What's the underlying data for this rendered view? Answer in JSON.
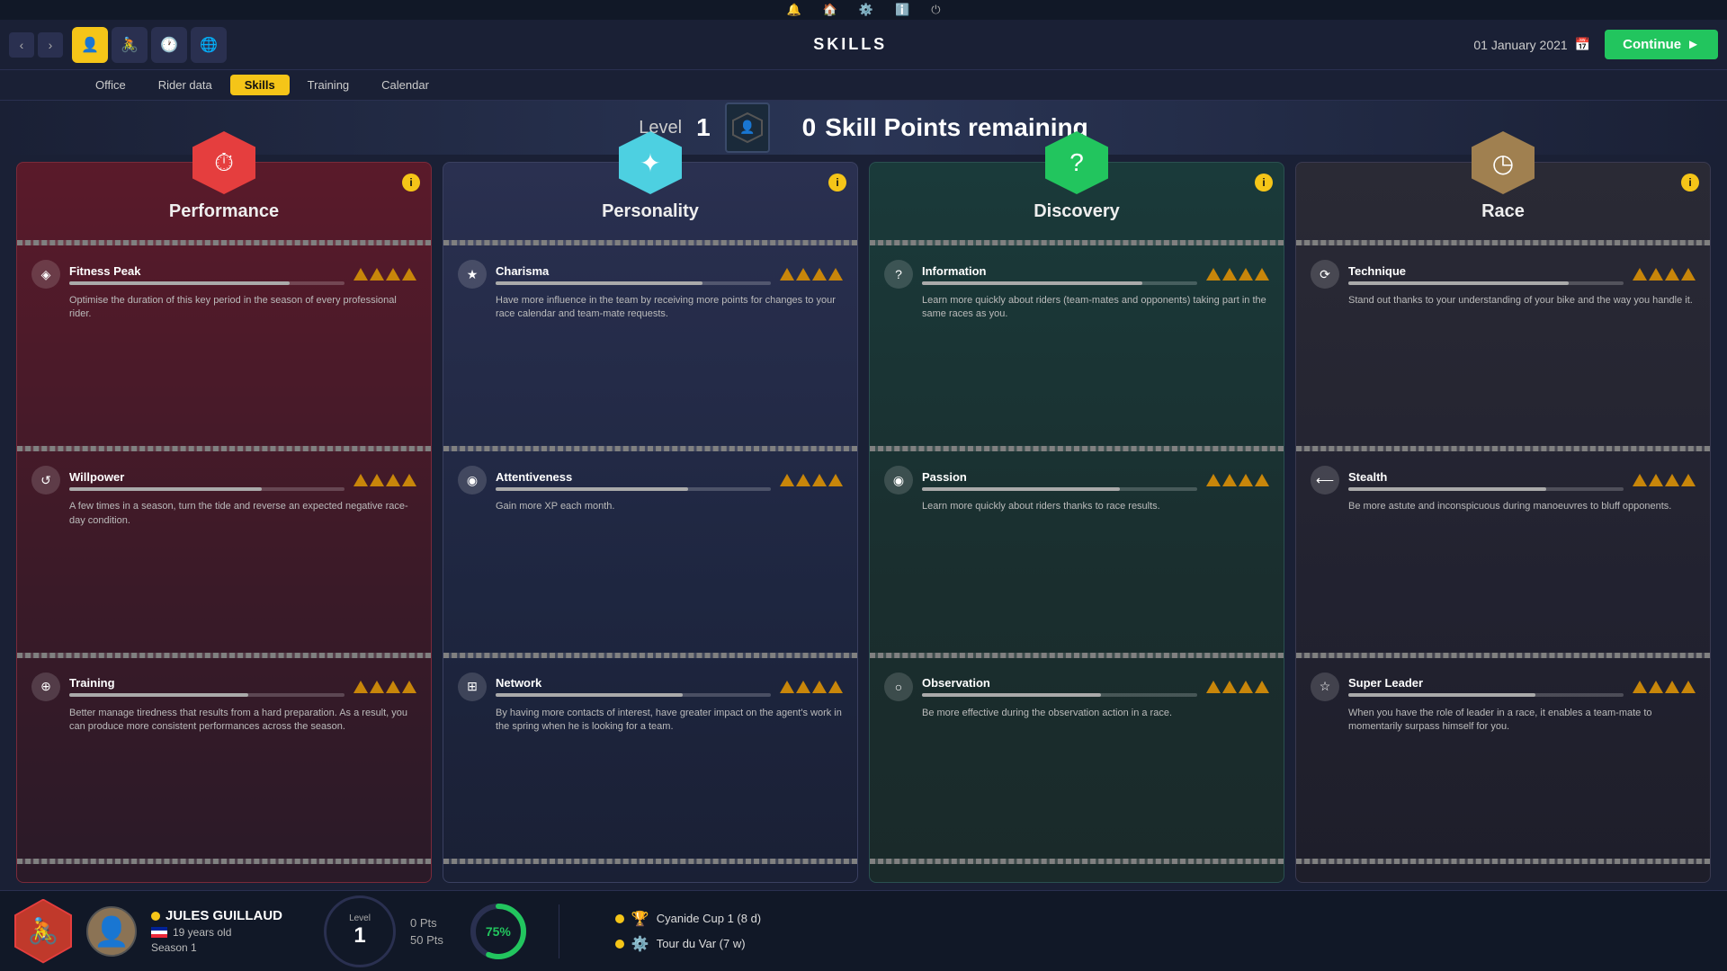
{
  "topbar": {
    "icons": [
      "🔔",
      "🏠",
      "⚙️",
      "ℹ️",
      "⏻"
    ]
  },
  "navbar": {
    "title": "SKILLS",
    "date": "01 January 2021",
    "continue_label": "Continue",
    "nav_icons": [
      {
        "name": "profile",
        "symbol": "👤",
        "active": true
      },
      {
        "name": "riders",
        "symbol": "🚴",
        "active": false
      },
      {
        "name": "clock",
        "symbol": "🕐",
        "active": false
      },
      {
        "name": "globe",
        "symbol": "🌐",
        "active": false
      }
    ]
  },
  "subnav": {
    "tabs": [
      "Office",
      "Rider data",
      "Skills",
      "Training",
      "Calendar"
    ],
    "active": "Skills"
  },
  "level_bar": {
    "level_label": "Level",
    "level_value": "1",
    "skill_points": "0",
    "skill_points_label": "Skill Points remaining"
  },
  "cards": [
    {
      "id": "performance",
      "title": "Performance",
      "hex_color": "red",
      "icon": "⏱",
      "skills": [
        {
          "name": "Fitness Peak",
          "icon": "◈",
          "desc": "Optimise the duration of this key period in the season of every professional rider.",
          "triangles": 4,
          "bar": 80
        },
        {
          "name": "Willpower",
          "icon": "↺",
          "desc": "A few times in a season, turn the tide and reverse an expected negative race-day condition.",
          "triangles": 4,
          "bar": 70
        },
        {
          "name": "Training",
          "icon": "⊕",
          "desc": "Better manage tiredness that results from a hard preparation. As a result, you can produce more consistent performances across the season.",
          "triangles": 4,
          "bar": 65
        }
      ]
    },
    {
      "id": "personality",
      "title": "Personality",
      "hex_color": "cyan",
      "icon": "✦",
      "skills": [
        {
          "name": "Charisma",
          "icon": "★",
          "desc": "Have more influence in the team by receiving more points for changes to your race calendar and team-mate requests.",
          "triangles": 4,
          "bar": 75
        },
        {
          "name": "Attentiveness",
          "icon": "◉",
          "desc": "Gain more XP each month.",
          "triangles": 4,
          "bar": 70
        },
        {
          "name": "Network",
          "icon": "⊞",
          "desc": "By having more contacts of interest, have greater impact on the agent's work in the spring when he is looking for a team.",
          "triangles": 4,
          "bar": 68
        }
      ]
    },
    {
      "id": "discovery",
      "title": "Discovery",
      "hex_color": "green",
      "icon": "?",
      "skills": [
        {
          "name": "Information",
          "icon": "?",
          "desc": "Learn more quickly about riders (team-mates and opponents) taking part in the same races as you.",
          "triangles": 4,
          "bar": 80
        },
        {
          "name": "Passion",
          "icon": "◉",
          "desc": "Learn more quickly about riders thanks to race results.",
          "triangles": 4,
          "bar": 72
        },
        {
          "name": "Observation",
          "icon": "○",
          "desc": "Be more effective during the observation action in a race.",
          "triangles": 4,
          "bar": 65
        }
      ]
    },
    {
      "id": "race",
      "title": "Race",
      "hex_color": "tan",
      "icon": "◷",
      "skills": [
        {
          "name": "Technique",
          "icon": "⟳",
          "desc": "Stand out thanks to your understanding of your bike and the way you handle it.",
          "triangles": 4,
          "bar": 80
        },
        {
          "name": "Stealth",
          "icon": "⟵",
          "desc": "Be more astute and inconspicuous during manoeuvres to bluff opponents.",
          "triangles": 4,
          "bar": 72
        },
        {
          "name": "Super Leader",
          "icon": "☆",
          "desc": "When you have the role of leader in a race, it enables a team-mate to momentarily surpass himself for you.",
          "triangles": 4,
          "bar": 68
        }
      ]
    }
  ],
  "bottom": {
    "rider_name": "JULES GUILLAUD",
    "rider_age": "19 years old",
    "rider_season": "Season 1",
    "level_label": "Level",
    "level_value": "1",
    "pts_current": "0 Pts",
    "pts_total": "50 Pts",
    "progress_pct": "75%",
    "races": [
      {
        "icon": "🏆",
        "label": "Cyanide Cup 1 (8 d)"
      },
      {
        "icon": "⚙️",
        "label": "Tour du Var (7 w)"
      }
    ]
  }
}
